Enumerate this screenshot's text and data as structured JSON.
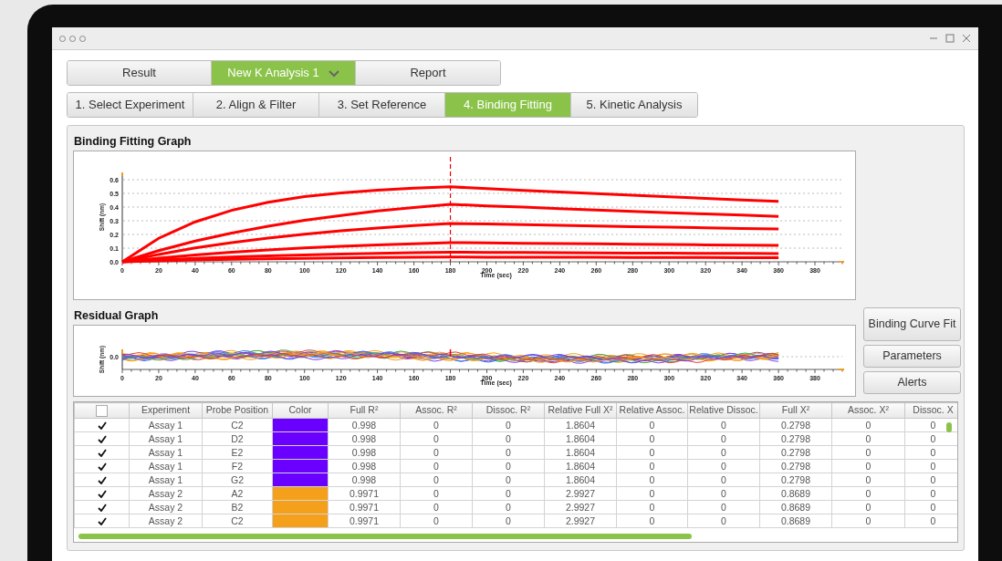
{
  "top_tabs": [
    {
      "label": "Result",
      "selected": false,
      "dropdown": false
    },
    {
      "label": "New K Analysis 1",
      "selected": true,
      "dropdown": true
    },
    {
      "label": "Report",
      "selected": false,
      "dropdown": false
    }
  ],
  "steps": [
    {
      "label": "1. Select Experiment",
      "selected": false
    },
    {
      "label": "2. Align & Filter",
      "selected": false
    },
    {
      "label": "3. Set Reference",
      "selected": false
    },
    {
      "label": "4. Binding Fitting",
      "selected": true
    },
    {
      "label": "5. Kinetic Analysis",
      "selected": false
    }
  ],
  "binding_graph": {
    "chart_data": {
      "type": "line",
      "title": "Binding Fitting Graph",
      "xlabel": "Time (sec)",
      "ylabel": "Shift (nm)",
      "x": [
        0,
        20,
        40,
        60,
        80,
        100,
        120,
        140,
        160,
        180,
        200,
        220,
        240,
        260,
        280,
        300,
        320,
        340,
        360
      ],
      "series": [
        {
          "color": "#ff0000",
          "values": [
            0,
            0.172,
            0.292,
            0.376,
            0.435,
            0.476,
            0.504,
            0.524,
            0.538,
            0.548,
            0.535,
            0.522,
            0.51,
            0.498,
            0.486,
            0.475,
            0.463,
            0.452,
            0.442
          ]
        },
        {
          "color": "#ff0000",
          "values": [
            0,
            0.081,
            0.151,
            0.21,
            0.26,
            0.303,
            0.339,
            0.371,
            0.397,
            0.42,
            0.409,
            0.399,
            0.388,
            0.378,
            0.369,
            0.359,
            0.35,
            0.341,
            0.332
          ]
        },
        {
          "color": "#ff0000",
          "values": [
            0,
            0.054,
            0.101,
            0.14,
            0.173,
            0.202,
            0.226,
            0.247,
            0.265,
            0.28,
            0.276,
            0.271,
            0.266,
            0.262,
            0.257,
            0.253,
            0.248,
            0.244,
            0.24
          ]
        },
        {
          "color": "#ff0000",
          "values": [
            0,
            0.027,
            0.05,
            0.07,
            0.087,
            0.101,
            0.113,
            0.124,
            0.132,
            0.14,
            0.138,
            0.135,
            0.133,
            0.131,
            0.128,
            0.126,
            0.124,
            0.122,
            0.12
          ]
        },
        {
          "color": "#ff0000",
          "values": [
            0,
            0.013,
            0.025,
            0.035,
            0.043,
            0.05,
            0.057,
            0.062,
            0.066,
            0.07,
            0.069,
            0.068,
            0.067,
            0.065,
            0.064,
            0.063,
            0.062,
            0.061,
            0.06
          ]
        },
        {
          "color": "#ff0000",
          "values": [
            0,
            0.007,
            0.013,
            0.018,
            0.022,
            0.025,
            0.028,
            0.031,
            0.033,
            0.035,
            0.034,
            0.034,
            0.033,
            0.033,
            0.032,
            0.032,
            0.031,
            0.03,
            0.03
          ]
        }
      ],
      "xlim": [
        0,
        395
      ],
      "ylim": [
        0,
        0.65
      ],
      "grid": true,
      "ref_lines": [
        {
          "axis": "x",
          "value": 180
        }
      ],
      "xticks": [
        0,
        20,
        40,
        60,
        80,
        100,
        120,
        140,
        160,
        180,
        200,
        220,
        240,
        260,
        280,
        300,
        320,
        340,
        360,
        380
      ],
      "yticks": [
        {
          "value": 0,
          "label": "0.0"
        },
        {
          "value": 0.1,
          "label": "0.1"
        },
        {
          "value": 0.2,
          "label": "0.2"
        },
        {
          "value": 0.3,
          "label": "0.3"
        },
        {
          "value": 0.4,
          "label": "0.4"
        },
        {
          "value": 0.5,
          "label": "0.5"
        },
        {
          "value": 0.6,
          "label": "0.6"
        }
      ]
    }
  },
  "residual_graph": {
    "title": "Residual Graph",
    "ylabel": "Shift (nm)",
    "xlabel": "Time (sec)",
    "yticks": [
      "0.0"
    ],
    "xticks": [
      "0",
      "20",
      "40",
      "60",
      "80",
      "100",
      "120",
      "140",
      "160",
      "180",
      "200",
      "220",
      "240",
      "260",
      "280",
      "300",
      "320",
      "340",
      "360",
      "380"
    ]
  },
  "side_buttons": [
    "Binding Curve Fit",
    "Parameters",
    "Alerts"
  ],
  "table": {
    "header_checked": false,
    "columns": [
      "Experiment",
      "Probe Position",
      "Color",
      "Full R²",
      "Assoc. R²",
      "Dissoc. R²",
      "Relative Full X²",
      "Relative Assoc. ",
      "Relative Dissoc.",
      "Full X²",
      "Assoc. X²",
      "Dissoc. X"
    ],
    "rows": [
      {
        "checked": true,
        "experiment": "Assay 1",
        "probe": "C2",
        "color": "#6a00ff",
        "values": [
          "0.998",
          "0",
          "0",
          "1.8604",
          "0",
          "0",
          "0.2798",
          "0",
          "0"
        ]
      },
      {
        "checked": true,
        "experiment": "Assay 1",
        "probe": "D2",
        "color": "#6a00ff",
        "values": [
          "0.998",
          "0",
          "0",
          "1.8604",
          "0",
          "0",
          "0.2798",
          "0",
          "0"
        ]
      },
      {
        "checked": true,
        "experiment": "Assay 1",
        "probe": "E2",
        "color": "#6a00ff",
        "values": [
          "0.998",
          "0",
          "0",
          "1.8604",
          "0",
          "0",
          "0.2798",
          "0",
          "0"
        ]
      },
      {
        "checked": true,
        "experiment": "Assay 1",
        "probe": "F2",
        "color": "#6a00ff",
        "values": [
          "0.998",
          "0",
          "0",
          "1.8604",
          "0",
          "0",
          "0.2798",
          "0",
          "0"
        ]
      },
      {
        "checked": true,
        "experiment": "Assay 1",
        "probe": "G2",
        "color": "#6a00ff",
        "values": [
          "0.998",
          "0",
          "0",
          "1.8604",
          "0",
          "0",
          "0.2798",
          "0",
          "0"
        ]
      },
      {
        "checked": true,
        "experiment": "Assay 2",
        "probe": "A2",
        "color": "#f5a01a",
        "values": [
          "0.9971",
          "0",
          "0",
          "2.9927",
          "0",
          "0",
          "0.8689",
          "0",
          "0"
        ]
      },
      {
        "checked": true,
        "experiment": "Assay 2",
        "probe": "B2",
        "color": "#f5a01a",
        "values": [
          "0.9971",
          "0",
          "0",
          "2.9927",
          "0",
          "0",
          "0.8689",
          "0",
          "0"
        ]
      },
      {
        "checked": true,
        "experiment": "Assay 2",
        "probe": "C2",
        "color": "#f5a01a",
        "values": [
          "0.9971",
          "0",
          "0",
          "2.9927",
          "0",
          "0",
          "0.8689",
          "0",
          "0"
        ]
      }
    ]
  }
}
